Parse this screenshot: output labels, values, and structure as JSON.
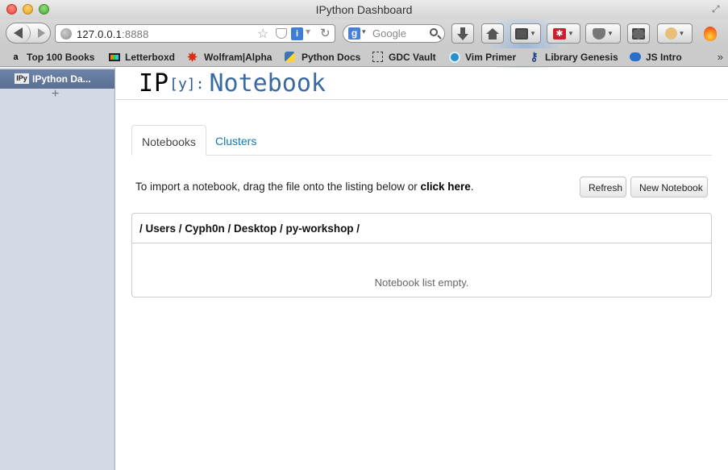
{
  "window": {
    "title": "IPython Dashboard"
  },
  "navbar": {
    "url_host": "127.0.0.1",
    "url_port": ":8888",
    "search_placeholder": "Google",
    "google_letter": "g"
  },
  "bookmarks": [
    {
      "label": "Top 100 Books",
      "icon": "amazon-icon"
    },
    {
      "label": "Letterboxd",
      "icon": "letterboxd-icon"
    },
    {
      "label": "Wolfram|Alpha",
      "icon": "wolfram-icon"
    },
    {
      "label": "Python Docs",
      "icon": "python-icon"
    },
    {
      "label": "GDC Vault",
      "icon": "dotted-square-icon"
    },
    {
      "label": "Vim Primer",
      "icon": "vim-icon"
    },
    {
      "label": "Library Genesis",
      "icon": "library-icon"
    },
    {
      "label": "JS Intro",
      "icon": "chat-icon"
    }
  ],
  "sidebar": {
    "tab_label": "IPython Da...",
    "tab_favicon": "IPy",
    "add_tab": "+"
  },
  "page": {
    "logo_ip": "IP",
    "logo_y": "[y]:",
    "logo_notebook": "Notebook",
    "tabs": [
      {
        "label": "Notebooks",
        "active": true
      },
      {
        "label": "Clusters",
        "active": false
      }
    ],
    "import_text": "To import a notebook, drag the file onto the listing below or ",
    "import_link": "click here",
    "import_end": ".",
    "refresh_label": "Refresh",
    "new_notebook_label": "New Notebook",
    "path": "/ Users / Cyph0n / Desktop / py-workshop /",
    "empty_message": "Notebook list empty."
  },
  "colors": {
    "link": "#0f78b8",
    "sidebar_bg": "#d3dae5",
    "sidebar_selected": "#5a6f92",
    "logo_blue": "#3a6aa0"
  }
}
